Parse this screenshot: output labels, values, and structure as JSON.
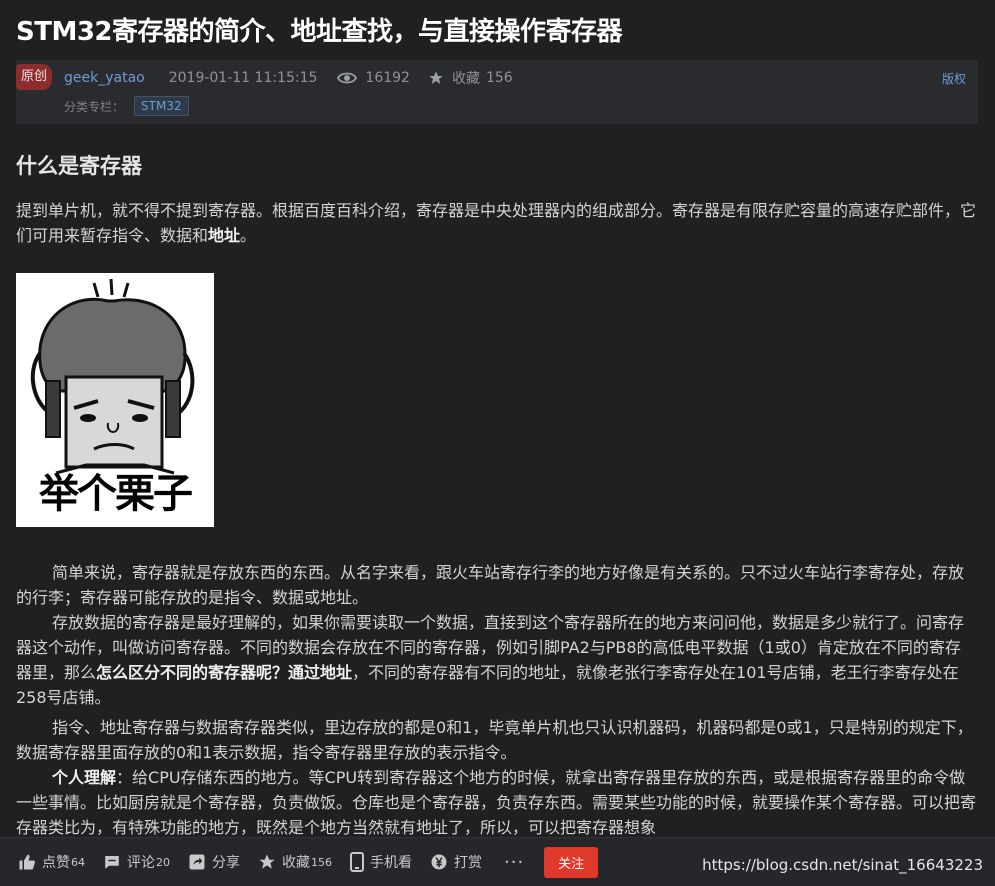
{
  "article": {
    "title": "STM32寄存器的简介、地址查找，与直接操作寄存器",
    "badge": "原创",
    "author": "geek_yatao",
    "date": "2019-01-11 11:15:15",
    "views": "16192",
    "favorite_label": "收藏",
    "favorite_count": "156",
    "copyright": "版权",
    "category_label": "分类专栏：",
    "category_tag": "STM32"
  },
  "content": {
    "heading": "什么是寄存器",
    "p1": {
      "text": "提到单片机，就不得不提到寄存器。根据百度百科介绍，寄存器是中央处理器内的组成部分。寄存器是有限存贮容量的高速存贮部件，它们可用来暂存指令、数据和",
      "bold": "地址",
      "end": "。"
    },
    "meme_caption": "举个栗子",
    "p2": "简单来说，寄存器就是存放东西的东西。从名字来看，跟火车站寄存行李的地方好像是有关系的。只不过火车站行李寄存处，存放的行李；寄存器可能存放的是指令、数据或地址。",
    "p3": {
      "a": "存放数据的寄存器是最好理解的，如果你需要读取一个数据，直接到这个寄存器所在的地方来问问他，数据是多少就行了。问寄存器这个动作，叫做访问寄存器。不同的数据会存放在不同的寄存器，例如引脚PA2与PB8的高低电平数据（1或0）肯定放在不同的寄存器里，那么",
      "bold": "怎么区分不同的寄存器呢？通过地址",
      "b": "，不同的寄存器有不同的地址，就像老张行李寄存处在101号店铺，老王行李寄存处在258号店铺。"
    },
    "p4": "指令、地址寄存器与数据寄存器类似，里边存放的都是0和1，毕竟单片机也只认识机器码，机器码都是0或1，只是特别的规定下，数据寄存器里面存放的0和1表示数据，指令寄存器里存放的表示指令。",
    "p5": {
      "bold": "个人理解",
      "text": "：给CPU存储东西的地方。等CPU转到寄存器这个地方的时候，就拿出寄存器里存放的东西，或是根据寄存器里的命令做一些事情。比如厨房就是个寄存器，负责做饭。仓库也是个寄存器，负责存东西。需要某些功能的时候，就要操作某个寄存器。可以把寄存器类比为，有特殊功能的地方，既然是个地方当然就有地址了，所以，可以把寄存器想象"
    }
  },
  "toolbar": {
    "like_label": "点赞",
    "like_count": "64",
    "comment_label": "评论",
    "comment_count": "20",
    "share_label": "分享",
    "fav_label": "收藏",
    "fav_count": "156",
    "mobile_label": "手机看",
    "tip_label": "打赏",
    "more_label": "···",
    "follow_label": "关注",
    "watermark": "https://blog.csdn.net/sinat_16643223"
  },
  "colors": {
    "background": "#1f2022",
    "accent_link": "#6f9bd1",
    "follow_red": "#e0392b",
    "badge_red": "#8b2d2d"
  }
}
